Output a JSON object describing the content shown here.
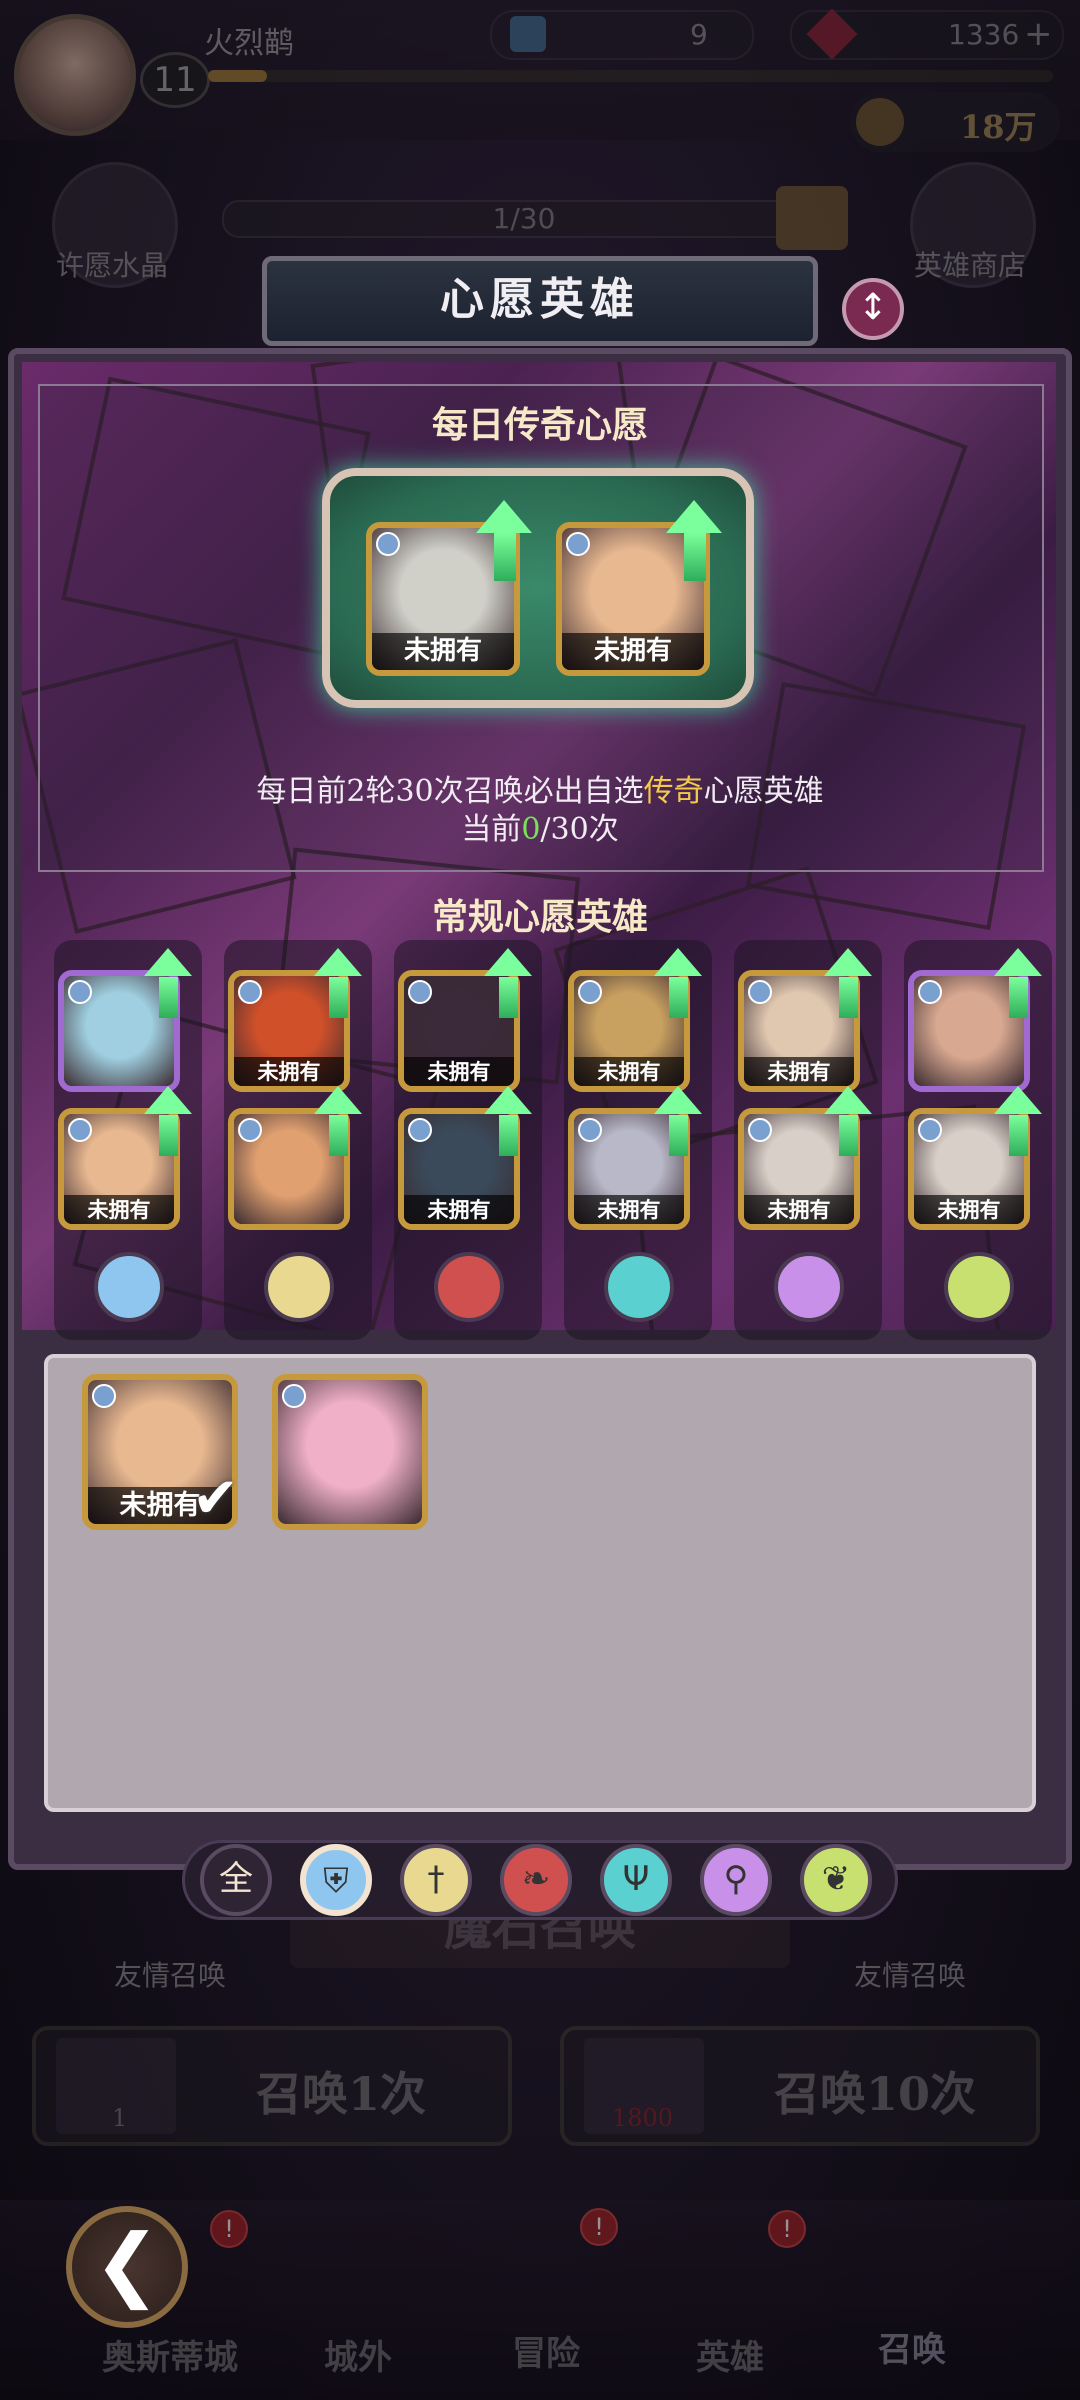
{
  "header": {
    "player_name": "火烈鹋",
    "level": "11",
    "xp_progress": 0.07,
    "scroll_count": "9",
    "gem_count": "1336",
    "gem_plus": "+",
    "gold_amount": "18万"
  },
  "side": {
    "left_label": "许愿水晶",
    "right_label": "英雄商店",
    "wish_progress": "1/30"
  },
  "background": {
    "banner_title": "魔石召唤",
    "friend_left": "友情召唤",
    "friend_right": "友情召唤",
    "summon1_label": "召唤1次",
    "summon1_cost": "1",
    "summon10_label": "召唤10次",
    "summon10_cost": "1800"
  },
  "nav": {
    "items": [
      {
        "label": "奥斯蒂城",
        "badge": "!"
      },
      {
        "label": "城外"
      },
      {
        "label": "冒险",
        "badge": "!"
      },
      {
        "label": "英雄",
        "badge": "!"
      },
      {
        "label": "召唤"
      }
    ],
    "back_icon": "back-arrow-icon"
  },
  "panel": {
    "title": "心愿英雄",
    "swap_icon": "swap-icon",
    "legend_section_title": "每日传奇心愿",
    "legend_heroes": [
      {
        "tag": "未拥有",
        "element": "nature",
        "color": "#d0d0c8"
      },
      {
        "tag": "未拥有",
        "element": "shield",
        "color": "#e8b890"
      }
    ],
    "desc_prefix": "每日前2轮30次召唤必出自选",
    "desc_highlight": "传奇",
    "desc_suffix": "心愿英雄",
    "current_prefix": "当前",
    "current_value": "0",
    "current_suffix": "/30次",
    "regular_section_title": "常规心愿英雄",
    "columns": [
      {
        "class": "shield",
        "icon_color": "#8fc6f0",
        "heroes": [
          {
            "tag": "",
            "color": "#9fcfe0",
            "purple": true
          },
          {
            "tag": "未拥有",
            "color": "#e8b890"
          }
        ]
      },
      {
        "class": "sword",
        "icon_color": "#e8d890",
        "heroes": [
          {
            "tag": "未拥有",
            "color": "#d0502a"
          },
          {
            "tag": "",
            "color": "#e0a070"
          }
        ]
      },
      {
        "class": "blade",
        "icon_color": "#d05050",
        "heroes": [
          {
            "tag": "未拥有",
            "color": "#3a2a3a"
          },
          {
            "tag": "未拥有",
            "color": "#3a4a5a"
          }
        ]
      },
      {
        "class": "trident",
        "icon_color": "#5ad0d0",
        "heroes": [
          {
            "tag": "未拥有",
            "color": "#c8a060"
          },
          {
            "tag": "未拥有",
            "color": "#b8b8c8"
          }
        ]
      },
      {
        "class": "staff",
        "icon_color": "#c890e8",
        "heroes": [
          {
            "tag": "未拥有",
            "color": "#e0c8b0"
          },
          {
            "tag": "未拥有",
            "color": "#d8d0c8"
          }
        ]
      },
      {
        "class": "leaf",
        "icon_color": "#c8e070",
        "heroes": [
          {
            "tag": "",
            "color": "#d8a890",
            "purple": true
          },
          {
            "tag": "未拥有",
            "color": "#d8d0c8"
          }
        ]
      }
    ],
    "pool": [
      {
        "tag": "未拥有",
        "color": "#e8b890",
        "checked": true
      },
      {
        "tag": "",
        "color": "#f0b0c8",
        "checked": false
      }
    ],
    "filters": [
      {
        "label": "全",
        "name": "all"
      },
      {
        "label": "⛨",
        "name": "shield",
        "color": "#8fc6f0",
        "selected": true
      },
      {
        "label": "†",
        "name": "sword",
        "color": "#e8d890"
      },
      {
        "label": "❧",
        "name": "blade",
        "color": "#d05050"
      },
      {
        "label": "Ψ",
        "name": "trident",
        "color": "#5ad0d0"
      },
      {
        "label": "⚲",
        "name": "staff",
        "color": "#c890e8"
      },
      {
        "label": "❦",
        "name": "leaf",
        "color": "#c8e070"
      }
    ]
  }
}
